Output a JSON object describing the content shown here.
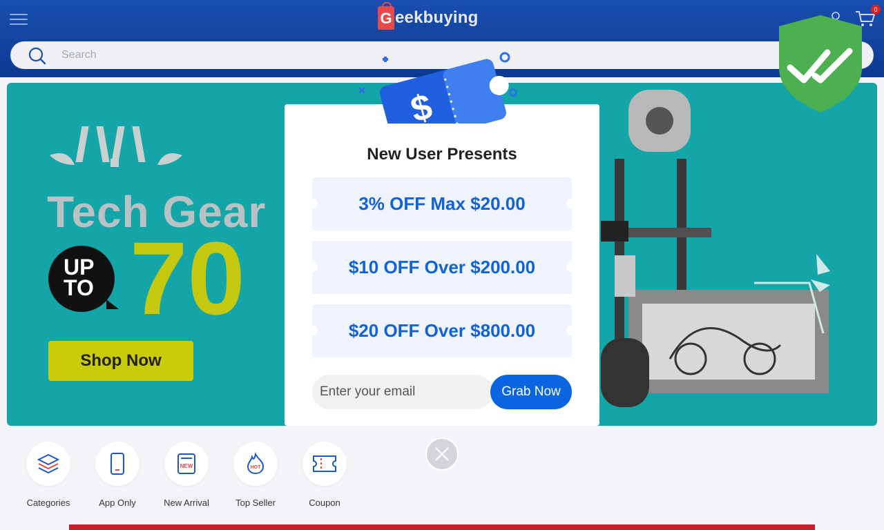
{
  "header": {
    "logo_initial": "G",
    "logo_text": "eekbuying",
    "cart_count": "0",
    "search_placeholder": "Search"
  },
  "banner": {
    "title": "Tech Gear",
    "up_to_line1": "UP",
    "up_to_line2": "TO",
    "discount": "70",
    "shop_button": "Shop Now"
  },
  "quick_links": [
    {
      "label": "Categories",
      "icon": "categories-icon"
    },
    {
      "label": "App Only",
      "icon": "phone-icon"
    },
    {
      "label": "New Arrival",
      "icon": "new-badge-icon"
    },
    {
      "label": "Top Seller",
      "icon": "hot-flame-icon"
    },
    {
      "label": "Coupon",
      "icon": "coupon-icon"
    }
  ],
  "popup": {
    "title": "New User Presents",
    "coupons": [
      "3% OFF Max $20.00",
      "$10 OFF Over $200.00",
      "$20 OFF Over $800.00"
    ],
    "email_placeholder": "Enter your email",
    "grab_button": "Grab Now",
    "ticket_symbol": "$",
    "new_badge": "NEW",
    "hot_badge": "HOT"
  },
  "colors": {
    "header_blue": "#1a4fb0",
    "banner_teal": "#14a5a9",
    "accent_blue": "#0a66e0",
    "coupon_text": "#0f63d6",
    "shield_green": "#4caf50"
  }
}
